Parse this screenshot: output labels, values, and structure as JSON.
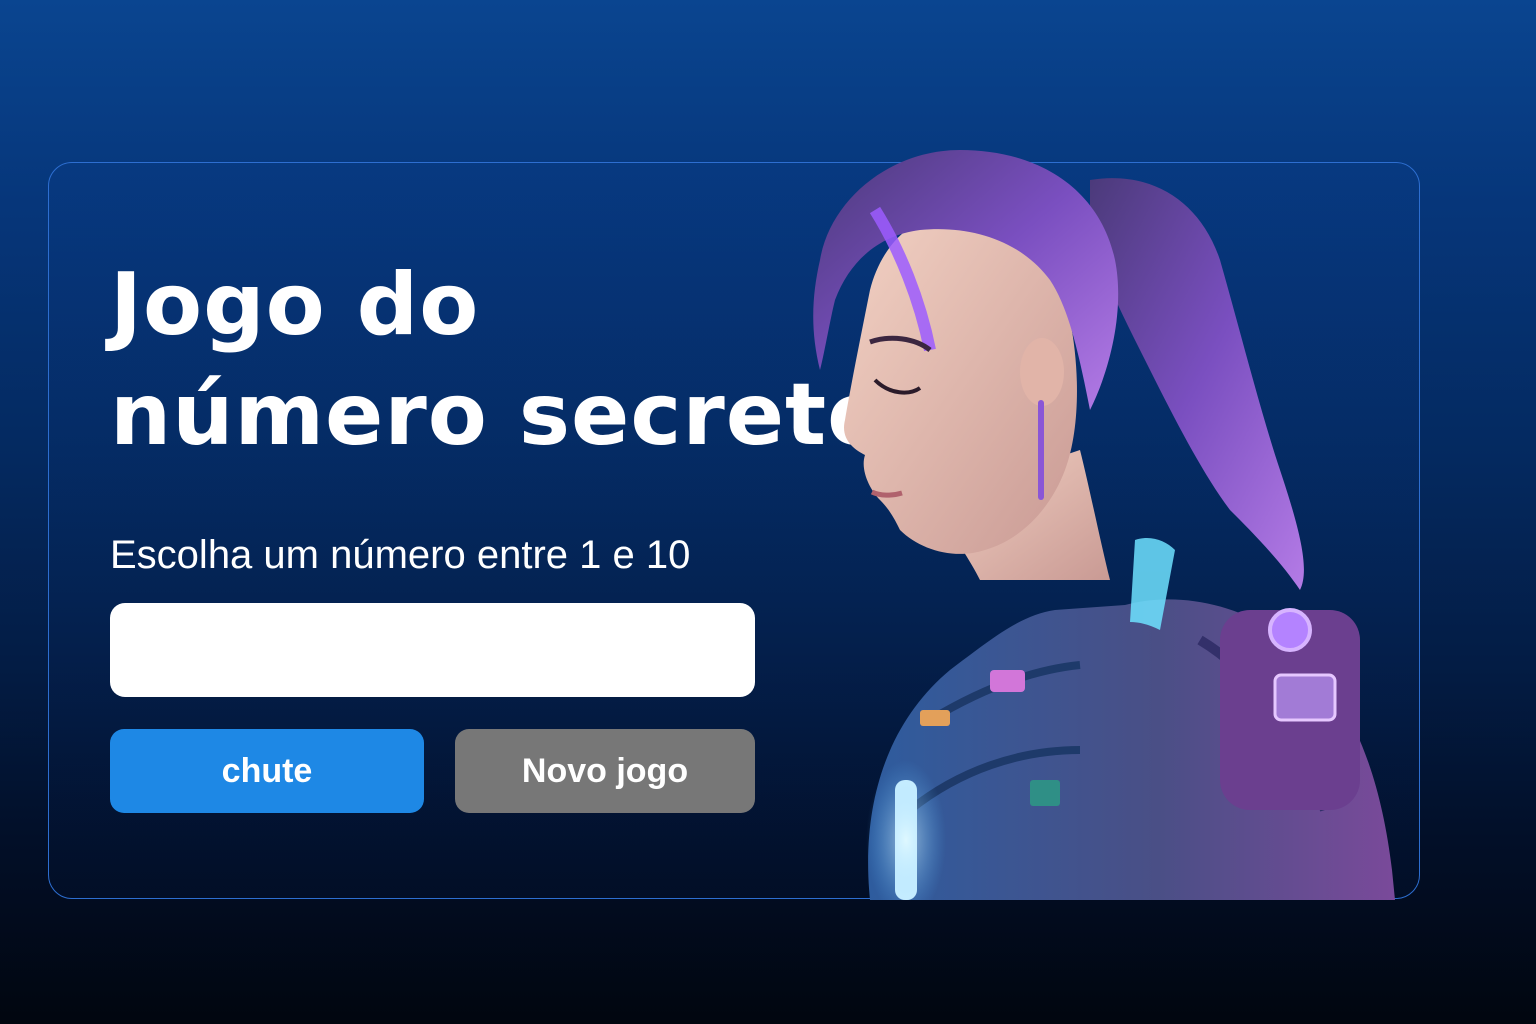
{
  "game": {
    "title_line1": "Jogo do",
    "title_line2": "número secreto",
    "instruction": "Escolha um número entre 1 e 10",
    "guess_input": {
      "value": "",
      "placeholder": ""
    },
    "guess_button_label": "chute",
    "new_game_button_label": "Novo jogo"
  },
  "illustration": {
    "subject": "sci-fi woman with purple ponytail in armored suit",
    "icon": "character-illustration"
  },
  "colors": {
    "background_top": "#0a4590",
    "background_bottom": "#01060f",
    "card_border": "#2d6ed0",
    "guess_button": "#1e88e5",
    "new_game_button": "#777777",
    "text": "#ffffff"
  }
}
